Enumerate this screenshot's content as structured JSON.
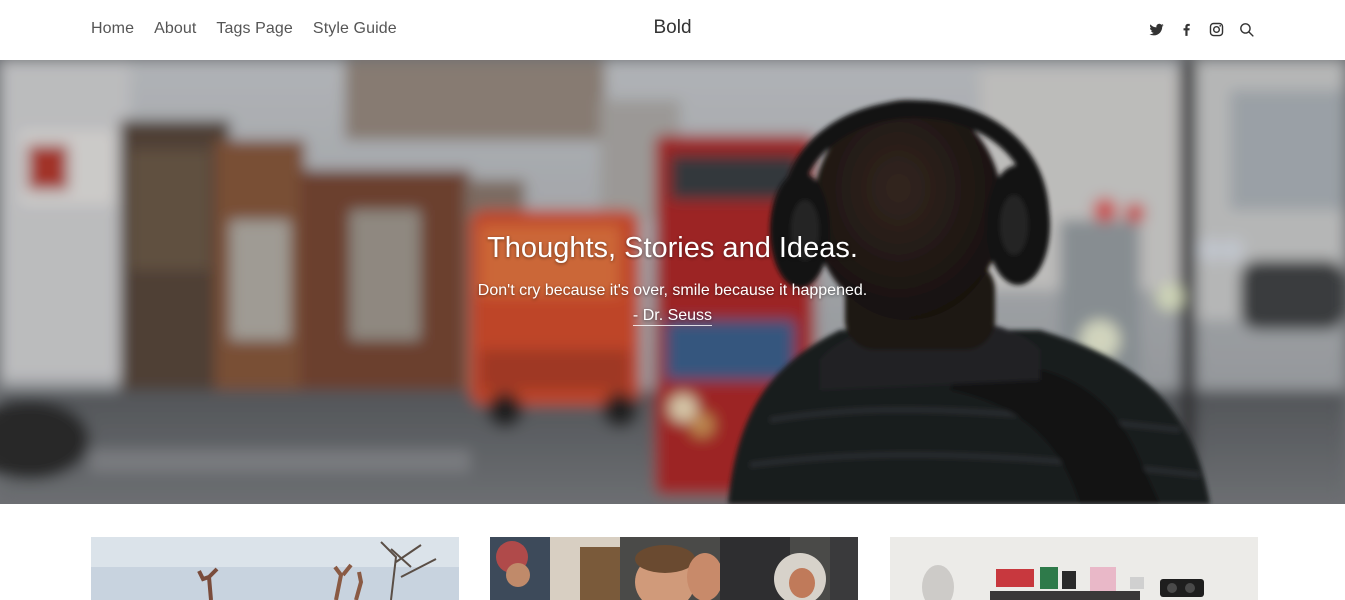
{
  "header": {
    "nav": [
      "Home",
      "About",
      "Tags Page",
      "Style Guide"
    ],
    "brand": "Bold",
    "social_icons": [
      "twitter-icon",
      "facebook-icon",
      "instagram-icon",
      "search-icon"
    ]
  },
  "hero": {
    "title": "Thoughts, Stories and Ideas.",
    "quote": "Don't cry because it's over, smile because it happened.",
    "author": "- Dr. Seuss"
  },
  "cards": [
    {
      "image": "people-raising-hands-sky-photo"
    },
    {
      "image": "crowd-smiling-man-photo"
    },
    {
      "image": "desk-calendar-shelf-photo"
    }
  ],
  "colors": {
    "text": "#333333",
    "nav_text": "#555555",
    "hero_text": "#ffffff",
    "background": "#ffffff"
  }
}
